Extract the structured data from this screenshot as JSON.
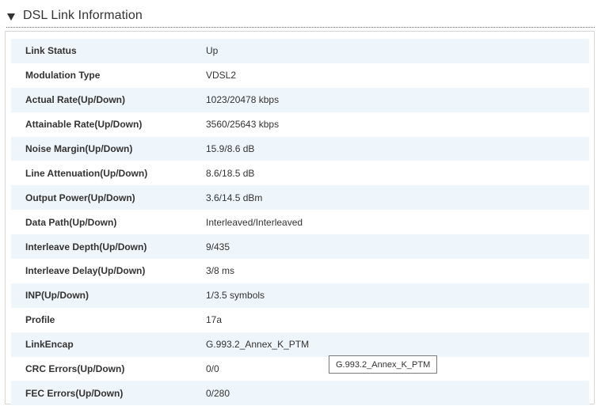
{
  "section": {
    "title": "DSL Link Information",
    "toggle_icon": "triangle-down-icon"
  },
  "rows": [
    {
      "label": "Link Status",
      "value": "Up"
    },
    {
      "label": "Modulation Type",
      "value": "VDSL2"
    },
    {
      "label": "Actual Rate(Up/Down)",
      "value": "1023/20478 kbps"
    },
    {
      "label": "Attainable Rate(Up/Down)",
      "value": "3560/25643 kbps"
    },
    {
      "label": "Noise Margin(Up/Down)",
      "value": "15.9/8.6 dB"
    },
    {
      "label": "Line Attenuation(Up/Down)",
      "value": "8.6/18.5 dB"
    },
    {
      "label": "Output Power(Up/Down)",
      "value": "3.6/14.5 dBm"
    },
    {
      "label": "Data Path(Up/Down)",
      "value": "Interleaved/Interleaved"
    },
    {
      "label": "Interleave Depth(Up/Down)",
      "value": "9/435"
    },
    {
      "label": "Interleave Delay(Up/Down)",
      "value": "3/8 ms"
    },
    {
      "label": "INP(Up/Down)",
      "value": "1/3.5 symbols"
    },
    {
      "label": "Profile",
      "value": "17a"
    },
    {
      "label": "LinkEncap",
      "value": "G.993.2_Annex_K_PTM"
    },
    {
      "label": "CRC Errors(Up/Down)",
      "value": "0/0"
    },
    {
      "label": "FEC Errors(Up/Down)",
      "value": "0/280"
    }
  ],
  "tooltip": {
    "text": "G.993.2_Annex_K_PTM"
  },
  "colors": {
    "row_stripe": "#eef5fb",
    "text": "#333333",
    "panel_border": "#d6d6d6"
  }
}
